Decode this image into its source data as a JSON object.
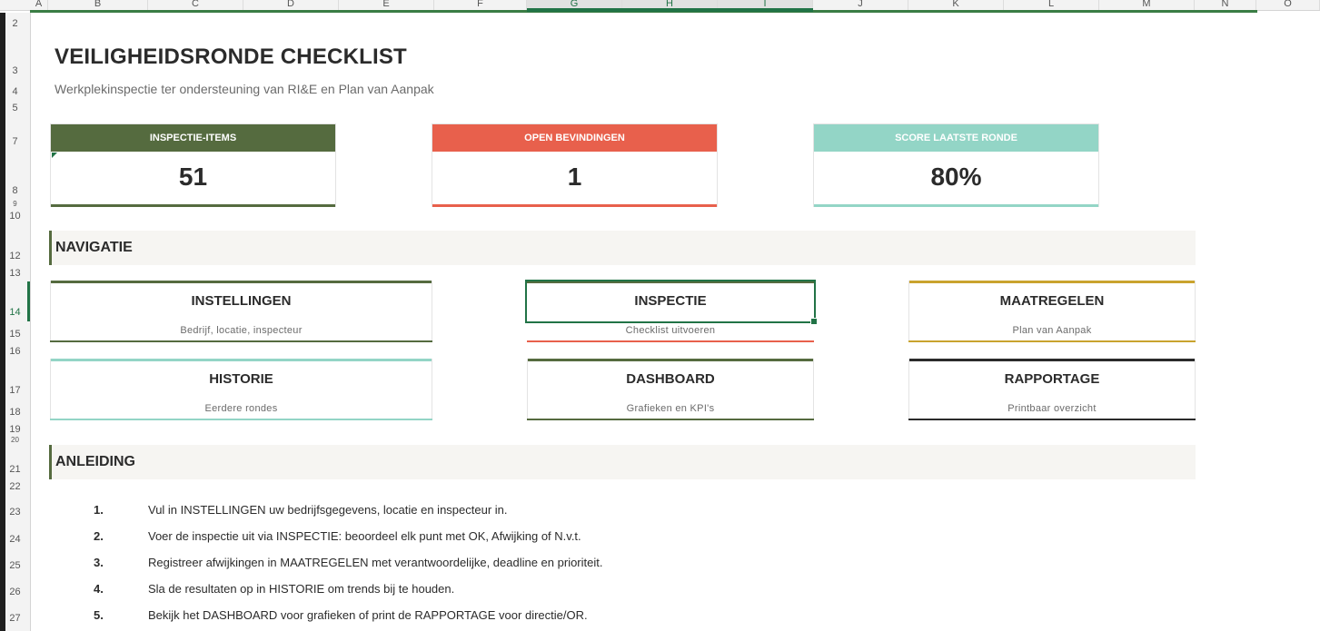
{
  "sheet": {
    "columns": [
      "A",
      "B",
      "C",
      "D",
      "E",
      "F",
      "G",
      "H",
      "I",
      "J",
      "K",
      "L",
      "M",
      "N",
      "O"
    ],
    "rows": [
      "2",
      "3",
      "4",
      "5",
      "7",
      "8",
      "9",
      "10",
      "12",
      "13",
      "14",
      "15",
      "16",
      "17",
      "18",
      "19",
      "20",
      "21",
      "22",
      "23",
      "24",
      "25",
      "26",
      "27"
    ]
  },
  "title": "VEILIGHEIDSRONDE CHECKLIST",
  "subtitle": "Werkplekinspectie ter ondersteuning van RI&E en Plan van Aanpak",
  "kpis": [
    {
      "label": "INSPECTIE-ITEMS",
      "value": "51",
      "color": "#556b3f"
    },
    {
      "label": "OPEN BEVINDINGEN",
      "value": "1",
      "color": "#e8604c"
    },
    {
      "label": "SCORE LAATSTE RONDE",
      "value": "80%",
      "color": "#93d5c6"
    }
  ],
  "navigation": {
    "heading": "NAVIGATIE",
    "cards": [
      {
        "title": "INSTELLINGEN",
        "subtitle": "Bedrijf, locatie, inspecteur",
        "color": "#556b3f"
      },
      {
        "title": "INSPECTIE",
        "subtitle": "Checklist uitvoeren",
        "color": "#e8604c"
      },
      {
        "title": "MAATREGELEN",
        "subtitle": "Plan van Aanpak",
        "color": "#c9a32e"
      },
      {
        "title": "HISTORIE",
        "subtitle": "Eerdere rondes",
        "color": "#93d5c6"
      },
      {
        "title": "DASHBOARD",
        "subtitle": "Grafieken en KPI's",
        "color": "#556b3f"
      },
      {
        "title": "RAPPORTAGE",
        "subtitle": "Printbaar overzicht",
        "color": "#2b2b2b"
      }
    ]
  },
  "instructions": {
    "heading": "ANLEIDING",
    "steps": [
      {
        "num": "1.",
        "text": "Vul in INSTELLINGEN uw bedrijfsgegevens, locatie en inspecteur in."
      },
      {
        "num": "2.",
        "text": "Voer de inspectie uit via INSPECTIE: beoordeel elk punt met OK, Afwijking of N.v.t."
      },
      {
        "num": "3.",
        "text": "Registreer afwijkingen in MAATREGELEN met verantwoordelijke, deadline en prioriteit."
      },
      {
        "num": "4.",
        "text": "Sla de resultaten op in HISTORIE om trends bij te houden."
      },
      {
        "num": "5.",
        "text": "Bekijk het DASHBOARD voor grafieken of print de RAPPORTAGE voor directie/OR."
      }
    ]
  }
}
